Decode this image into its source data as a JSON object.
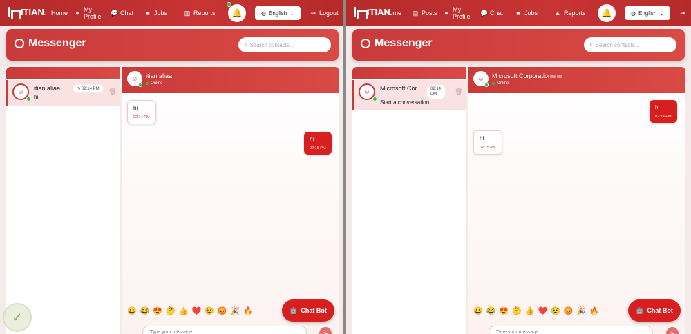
{
  "left": {
    "nav": {
      "brand": "ITIAN",
      "items": [
        {
          "label": "Home",
          "icon": "home-icon"
        },
        {
          "label": "My Profile",
          "icon": "user-icon"
        },
        {
          "label": "Chat",
          "icon": "chat-icon"
        },
        {
          "label": "Jobs",
          "icon": "briefcase-icon"
        },
        {
          "label": "Reports",
          "icon": "chart-icon"
        }
      ],
      "language": "English",
      "logout": "Logout"
    },
    "header": {
      "title": "Messenger",
      "search_placeholder": "Search contacts..."
    },
    "contacts": [
      {
        "name": "itian aliaa",
        "last_message": "hi",
        "time": "02:14 PM"
      }
    ],
    "chat": {
      "name": "itian aliaa",
      "status": "Online",
      "messages": [
        {
          "text": "hi",
          "time": "02:14 PM",
          "direction": "in"
        },
        {
          "text": "hi",
          "time": "02:15 PM",
          "direction": "out"
        }
      ],
      "input_placeholder": "Type your message...",
      "chatbot_label": "Chat Bot"
    }
  },
  "right": {
    "nav": {
      "brand": "ITIAN",
      "items": [
        {
          "label": "Home",
          "icon": "home-icon"
        },
        {
          "label": "Posts",
          "icon": "document-icon"
        },
        {
          "label": "My Profile",
          "icon": "user-icon"
        },
        {
          "label": "Chat",
          "icon": "chat-icon"
        },
        {
          "label": "Jobs",
          "icon": "briefcase-icon"
        },
        {
          "label": "Reports",
          "icon": "warning-icon"
        }
      ],
      "language": "English"
    },
    "header": {
      "title": "Messenger",
      "search_placeholder": "Search contacts..."
    },
    "contacts": [
      {
        "name": "Microsoft Cor...",
        "last_message": "Start a conversation...",
        "time": "02:14 PM"
      }
    ],
    "chat": {
      "name": "Microsoft Corporationnnn",
      "status": "Online",
      "messages": [
        {
          "text": "hi",
          "time": "02:14 PM",
          "direction": "out"
        },
        {
          "text": "hi",
          "time": "02:15 PM",
          "direction": "in"
        }
      ],
      "input_placeholder": "Type your message...",
      "chatbot_label": "Chat Bot"
    }
  },
  "emojis": [
    "😀",
    "😂",
    "😍",
    "🤔",
    "👍",
    "❤️",
    "😢",
    "😡",
    "🎉",
    "🔥"
  ],
  "colors": {
    "primary": "#c93a3a",
    "online": "#27c24c",
    "bubble_out": "#d81f1f"
  }
}
